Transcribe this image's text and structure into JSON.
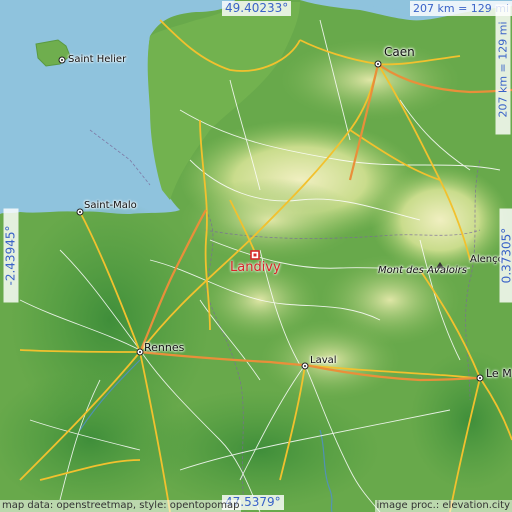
{
  "coordinates": {
    "lat_top": "49.40233°",
    "lat_bottom": "47.5379°",
    "lon_left": "-2.43945°",
    "lon_right": "0.37305°"
  },
  "scale": {
    "horizontal": "207 km = 129 mi",
    "vertical": "207 km = 129 mi"
  },
  "main_place": "Landivy",
  "places": {
    "saint_helier": "Saint Helier",
    "caen": "Caen",
    "saint_malo": "Saint-Malo",
    "mont_des_avaloirs": "Mont des Avaloirs",
    "alencon": "Alenço",
    "rennes": "Rennes",
    "laval": "Laval",
    "le_mans": "Le M"
  },
  "credits": {
    "left": "map data: openstreetmap, style: opentopomap",
    "right": "image proc.: elevation.city"
  },
  "colors": {
    "sea": "#8fc3dd",
    "land_low": "#6fae4e",
    "land_high": "#e8eab0",
    "road_major": "#f2c12e",
    "road_highway": "#e98f3a",
    "main_marker": "#d8262a",
    "coordinate_text": "#3a63c8"
  }
}
